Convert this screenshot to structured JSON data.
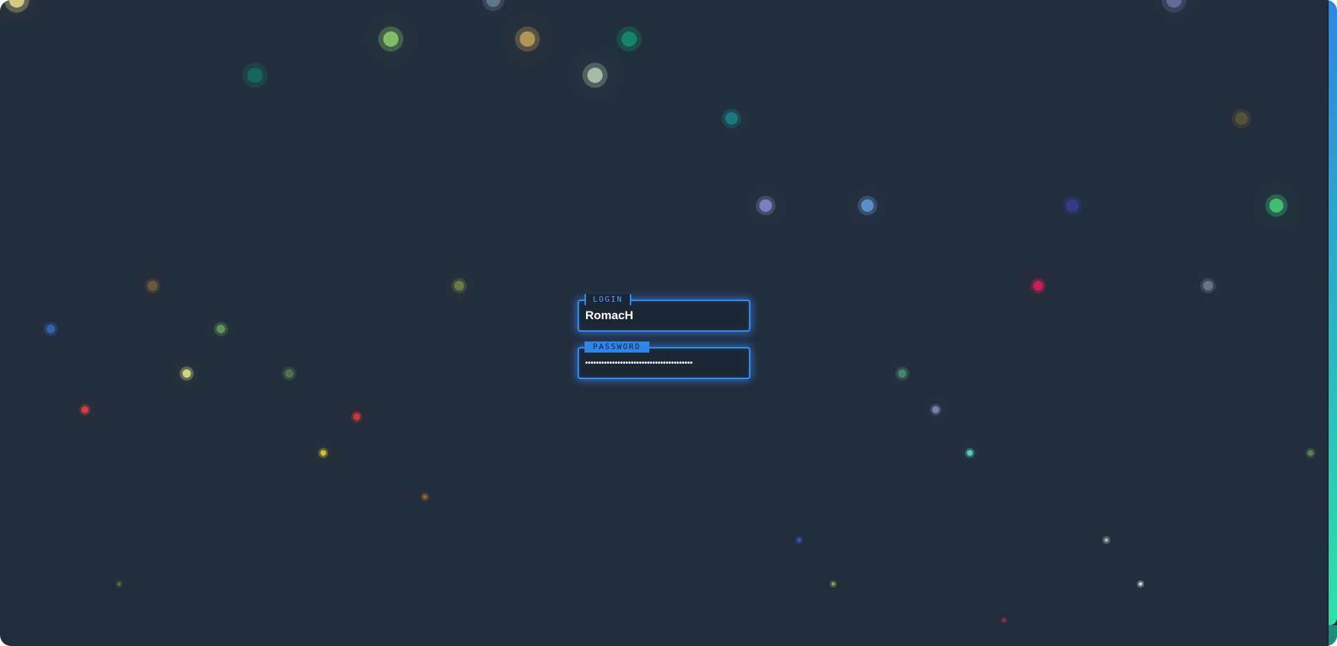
{
  "form": {
    "login_label": "LOGIN",
    "login_value": "RomacH",
    "password_label": "PASSWORD",
    "password_masked": "••••••••••••••••••••••••••••••••••••••••"
  },
  "colors": {
    "background": "#222d3c",
    "accent": "#3b8ef0",
    "accent_active": "#2f86e8",
    "scrollbar_top": "#2f86e0",
    "scrollbar_bottom": "#2fe0a8"
  }
}
